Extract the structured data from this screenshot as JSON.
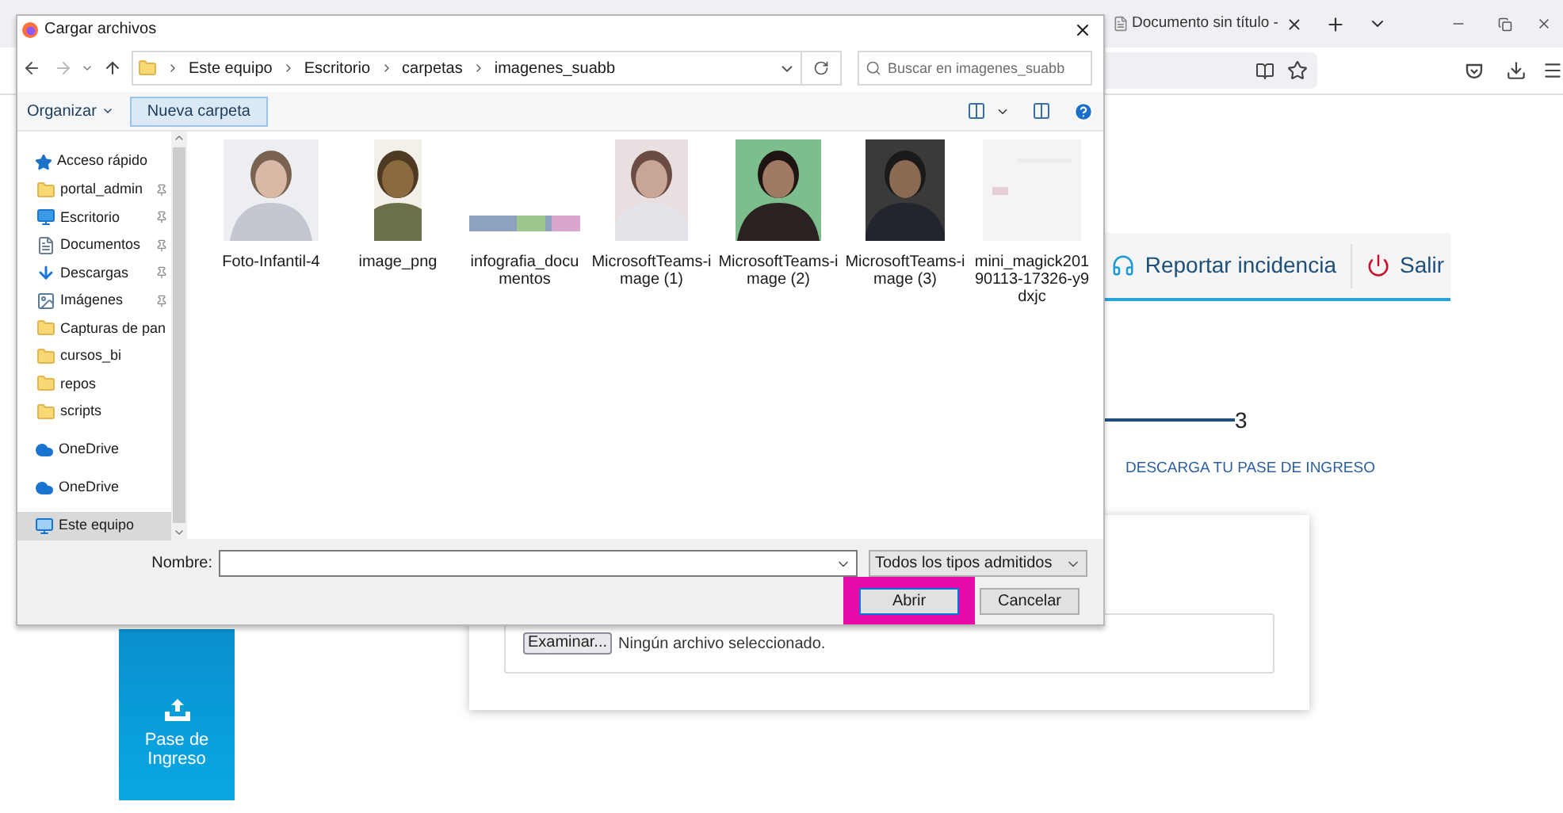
{
  "browser": {
    "tab_title": "Documento sin título -"
  },
  "header_links": [
    {
      "label": "Reportar incidencia",
      "kind": "support"
    },
    {
      "label": "Salir",
      "kind": "logout"
    }
  ],
  "stepper": {
    "step": "3",
    "label": "DESCARGA TU PASE DE INGRESO"
  },
  "tile": {
    "label": "Pase de Ingreso"
  },
  "upload": {
    "button": "Examinar...",
    "status": "Ningún archivo seleccionado."
  },
  "dialog": {
    "title": "Cargar archivos",
    "breadcrumb": [
      "Este equipo",
      "Escritorio",
      "carpetas",
      "imagenes_suabb"
    ],
    "search_placeholder": "Buscar en imagenes_suabb",
    "organize": "Organizar",
    "new_folder": "Nueva carpeta",
    "nav": [
      {
        "label": "Acceso rápido",
        "kind": "star",
        "selected": false,
        "children": [
          {
            "label": "portal_admin",
            "kind": "folder",
            "pinned": true,
            "selected": false
          },
          {
            "label": "Escritorio",
            "kind": "desktop",
            "pinned": true,
            "selected": false
          },
          {
            "label": "Documentos",
            "kind": "documents",
            "pinned": true,
            "selected": false
          },
          {
            "label": "Descargas",
            "kind": "downloads",
            "pinned": true,
            "selected": false
          },
          {
            "label": "Imágenes",
            "kind": "images",
            "pinned": true,
            "selected": false
          },
          {
            "label": "Capturas de pan",
            "kind": "folder",
            "pinned": false,
            "selected": false
          },
          {
            "label": "cursos_bi",
            "kind": "folder",
            "pinned": false,
            "selected": false
          },
          {
            "label": "repos",
            "kind": "folder",
            "pinned": false,
            "selected": false
          },
          {
            "label": "scripts",
            "kind": "folder",
            "pinned": false,
            "selected": false
          }
        ]
      },
      {
        "label": "OneDrive",
        "kind": "cloud",
        "selected": false
      },
      {
        "label": "OneDrive",
        "kind": "cloud",
        "selected": false
      },
      {
        "label": "Este equipo",
        "kind": "pc",
        "selected": true
      }
    ],
    "files": [
      {
        "name": "Foto-Infantil-4",
        "kind": "picture"
      },
      {
        "name": "image_png",
        "kind": "picture"
      },
      {
        "name": "infografia_documentos",
        "kind": "picture"
      },
      {
        "name": "MicrosoftTeams-image (1)",
        "kind": "picture"
      },
      {
        "name": "MicrosoftTeams-image (2)",
        "kind": "picture"
      },
      {
        "name": "MicrosoftTeams-image (3)",
        "kind": "picture"
      },
      {
        "name": "mini_magick20190113-17326-y9dxjc",
        "kind": "picture"
      }
    ],
    "filename_label": "Nombre:",
    "file_type": "Todos los tipos admitidos",
    "buttons": [
      {
        "label": "Abrir",
        "default": true,
        "highlighted": true
      },
      {
        "label": "Cancelar",
        "default": false,
        "highlighted": false
      }
    ]
  }
}
